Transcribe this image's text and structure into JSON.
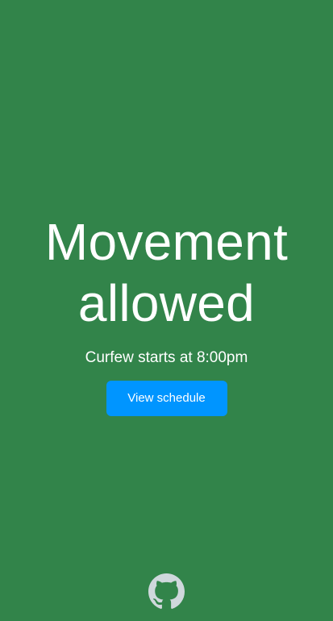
{
  "status": {
    "headline_line1": "Movement",
    "headline_line2": "allowed",
    "subtitle": "Curfew starts at 8:00pm"
  },
  "actions": {
    "view_schedule_label": "View schedule"
  },
  "footer": {
    "icon": "github-icon"
  },
  "colors": {
    "background": "#32844a",
    "button": "#0095ff",
    "text": "#ffffff",
    "icon": "#cfd8dc"
  }
}
